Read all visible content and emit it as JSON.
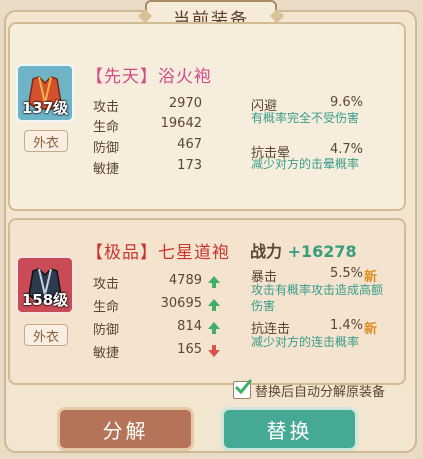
{
  "header": {
    "title": "当前装备"
  },
  "current": {
    "level": "137级",
    "tag": "外衣",
    "name": "【先天】浴火袍",
    "stats": [
      {
        "label": "攻击",
        "value": "2970"
      },
      {
        "label": "生命",
        "value": "19642"
      },
      {
        "label": "防御",
        "value": "467"
      },
      {
        "label": "敏捷",
        "value": "173"
      }
    ],
    "special": [
      {
        "label": "闪避",
        "value": "9.6%",
        "desc": "有概率完全不受伤害"
      },
      {
        "label": "抗击晕",
        "value": "4.7%",
        "desc": "减少对方的击晕概率"
      }
    ]
  },
  "new_item": {
    "level": "158级",
    "tag": "外衣",
    "name": "【极品】七星道袍",
    "power_label": "战力",
    "power_value": "+16278",
    "stats": [
      {
        "label": "攻击",
        "value": "4789",
        "trend": "up"
      },
      {
        "label": "生命",
        "value": "30695",
        "trend": "up"
      },
      {
        "label": "防御",
        "value": "814",
        "trend": "up"
      },
      {
        "label": "敏捷",
        "value": "165",
        "trend": "down"
      }
    ],
    "special": [
      {
        "label": "暴击",
        "value": "5.5%",
        "badge": "新",
        "desc1": "攻击有概率攻击造成高额",
        "desc2": "伤害"
      },
      {
        "label": "抗连击",
        "value": "1.4%",
        "badge": "新",
        "desc1": "减少对方的连击概率"
      }
    ]
  },
  "auto_decompose": {
    "label": "替换后自动分解原装备",
    "checked": true
  },
  "buttons": {
    "decompose": "分解",
    "replace": "替换"
  },
  "colors": {
    "up": "#3fae6a",
    "down": "#d9534f",
    "teal_text": "#3a9d8b"
  }
}
